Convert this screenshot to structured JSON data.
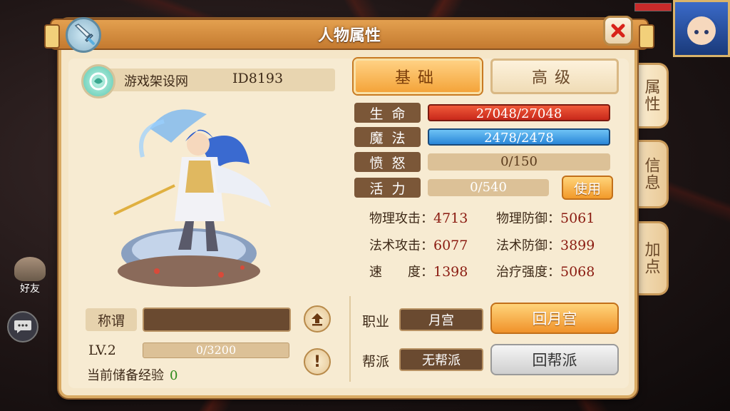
{
  "window": {
    "title": "人物属性"
  },
  "side_tabs": [
    {
      "label": "属性"
    },
    {
      "label": "信息"
    },
    {
      "label": "加点"
    }
  ],
  "player": {
    "name": "游戏架设网",
    "id": "ID8193"
  },
  "left": {
    "title_label": "称谓",
    "title_value": "",
    "level": "LV.2",
    "exp": "0/3200",
    "stored_exp_label": "当前储备经验",
    "stored_exp_value": "0",
    "info_btn": "!"
  },
  "tabs": {
    "basic": "基础",
    "advanced": "高级"
  },
  "stats": {
    "hp": {
      "label": "生命",
      "value": "27048/27048"
    },
    "mp": {
      "label": "魔法",
      "value": "2478/2478"
    },
    "rage": {
      "label": "愤怒",
      "value": "0/150"
    },
    "vitality": {
      "label": "活力",
      "value": "0/540"
    },
    "use_label": "使用"
  },
  "attributes": [
    {
      "label": "物理攻击：",
      "value": "4713"
    },
    {
      "label": "物理防御：",
      "value": "5061"
    },
    {
      "label": "法术攻击：",
      "value": "6077"
    },
    {
      "label": "法术防御：",
      "value": "3899"
    },
    {
      "label": "速　　度：",
      "value": "1398"
    },
    {
      "label": "治疗强度：",
      "value": "5068"
    }
  ],
  "job": {
    "job_label": "职业",
    "job_value": "月宫",
    "return_job": "回月宫",
    "guild_label": "帮派",
    "guild_value": "无帮派",
    "return_guild": "回帮派"
  },
  "hud": {
    "friend_label": "好友"
  },
  "colors": {
    "accent": "#f4a43a",
    "hp": "#d8311e",
    "mp": "#3a94e0",
    "panel": "#f5e6c8"
  }
}
